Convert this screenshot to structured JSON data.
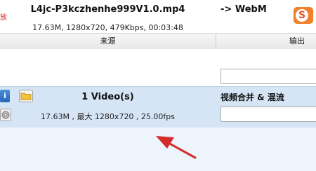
{
  "top": {
    "corner_text": "放"
  },
  "header": {
    "source_label": "来源",
    "output_label": "输出"
  },
  "rows": [
    {
      "name": "L4jc-P3kczhenhe999V1.0.mp4",
      "info": "17.63M, 1280x720, 479Kbps, 00:03:48",
      "output_format": "-> WebM"
    }
  ],
  "merge_row": {
    "count_label": "1 Video(s)",
    "summary": "17.63M , 最大 1280x720 , 25.00fps",
    "output_label": "视频合并 & 混流"
  },
  "icons": {
    "info": "info-icon",
    "folder": "folder-icon",
    "gear": "gear-icon",
    "sogou": "sogou-ime-icon",
    "arrow": "red-arrow-annotation"
  },
  "colors": {
    "selected_row": "#d5e5f6",
    "lower_bg": "#eef4fb",
    "arrow": "#d42b2b",
    "sogou": "#f0802c"
  }
}
